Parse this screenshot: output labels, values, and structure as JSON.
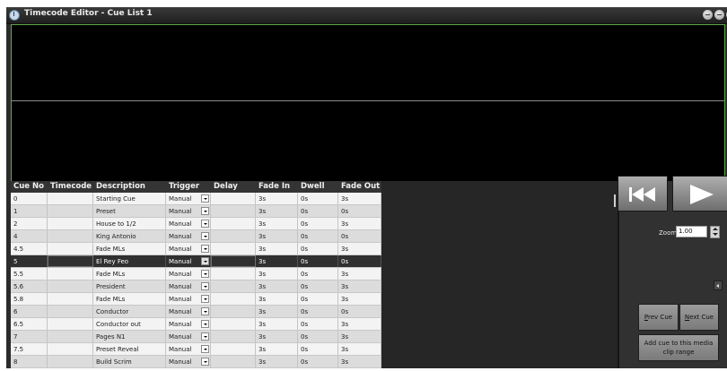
{
  "window": {
    "title": "Timecode Editor - Cue List 1"
  },
  "grid": {
    "headers": {
      "cue_no": "Cue No",
      "timecode": "Timecode",
      "description": "Description",
      "trigger": "Trigger",
      "delay": "Delay",
      "fade_in": "Fade In",
      "dwell": "Dwell",
      "fade_out": "Fade Out"
    },
    "selected_row_index": 5,
    "rows": [
      {
        "cue": "0",
        "timecode": "",
        "description": "Starting Cue",
        "trigger": "Manual",
        "delay": "",
        "fade_in": "3s",
        "dwell": "0s",
        "fade_out": "3s"
      },
      {
        "cue": "1",
        "timecode": "",
        "description": "Preset",
        "trigger": "Manual",
        "delay": "",
        "fade_in": "3s",
        "dwell": "0s",
        "fade_out": "0s"
      },
      {
        "cue": "2",
        "timecode": "",
        "description": "House to 1/2",
        "trigger": "Manual",
        "delay": "",
        "fade_in": "3s",
        "dwell": "0s",
        "fade_out": "3s"
      },
      {
        "cue": "4",
        "timecode": "",
        "description": "King Antonio",
        "trigger": "Manual",
        "delay": "",
        "fade_in": "3s",
        "dwell": "0s",
        "fade_out": "0s"
      },
      {
        "cue": "4.5",
        "timecode": "",
        "description": "Fade MLs",
        "trigger": "Manual",
        "delay": "",
        "fade_in": "3s",
        "dwell": "0s",
        "fade_out": "3s"
      },
      {
        "cue": "5",
        "timecode": "",
        "description": "El Rey Feo",
        "trigger": "Manual",
        "delay": "",
        "fade_in": "3s",
        "dwell": "0s",
        "fade_out": "0s"
      },
      {
        "cue": "5.5",
        "timecode": "",
        "description": "Fade MLs",
        "trigger": "Manual",
        "delay": "",
        "fade_in": "3s",
        "dwell": "0s",
        "fade_out": "3s"
      },
      {
        "cue": "5.6",
        "timecode": "",
        "description": "President",
        "trigger": "Manual",
        "delay": "",
        "fade_in": "3s",
        "dwell": "0s",
        "fade_out": "3s"
      },
      {
        "cue": "5.8",
        "timecode": "",
        "description": "Fade MLs",
        "trigger": "Manual",
        "delay": "",
        "fade_in": "3s",
        "dwell": "0s",
        "fade_out": "3s"
      },
      {
        "cue": "6",
        "timecode": "",
        "description": "Conductor",
        "trigger": "Manual",
        "delay": "",
        "fade_in": "3s",
        "dwell": "0s",
        "fade_out": "0s"
      },
      {
        "cue": "6.5",
        "timecode": "",
        "description": "Conductor out",
        "trigger": "Manual",
        "delay": "",
        "fade_in": "3s",
        "dwell": "0s",
        "fade_out": "3s"
      },
      {
        "cue": "7",
        "timecode": "",
        "description": "Pages N1",
        "trigger": "Manual",
        "delay": "",
        "fade_in": "3s",
        "dwell": "0s",
        "fade_out": "3s"
      },
      {
        "cue": "7.5",
        "timecode": "",
        "description": "Preset Reveal",
        "trigger": "Manual",
        "delay": "",
        "fade_in": "3s",
        "dwell": "0s",
        "fade_out": "3s"
      },
      {
        "cue": "8",
        "timecode": "",
        "description": "Build Scrim",
        "trigger": "Manual",
        "delay": "",
        "fade_in": "3s",
        "dwell": "0s",
        "fade_out": "3s"
      }
    ]
  },
  "controls": {
    "zoom_label": "Zoom",
    "zoom_value": "1.00",
    "prev_cue_mnemonic": "P",
    "prev_cue_rest": "rev Cue",
    "next_cue_mnemonic": "N",
    "next_cue_rest": "ext Cue",
    "add_cue_label": "Add cue to this media clip range"
  },
  "icons": {
    "app": "timecode-app-icon",
    "rewind": "rewind-to-start-icon",
    "play": "play-icon",
    "scroll_left": "scroll-left-arrow-icon"
  },
  "colors": {
    "waveform_border": "#5fa84a",
    "selected_row": "#303030",
    "header_bg": "#343434"
  }
}
